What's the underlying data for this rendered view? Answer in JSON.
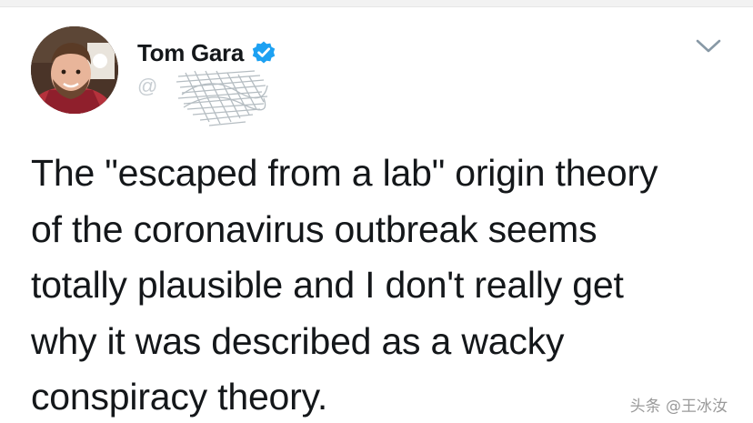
{
  "user": {
    "display_name": "Tom Gara",
    "handle": "@",
    "verified": true,
    "verified_color": "#1da1f2"
  },
  "tweet": {
    "lines": [
      "The \"escaped from a lab\" origin theory",
      "of the coronavirus outbreak seems",
      "totally plausible and I don't really get",
      "why it was described as a wacky",
      "conspiracy theory."
    ]
  },
  "icons": {
    "verified": "verified-badge-icon",
    "menu": "chevron-down-icon"
  },
  "watermark": {
    "text": "头条 @王冰汝"
  }
}
